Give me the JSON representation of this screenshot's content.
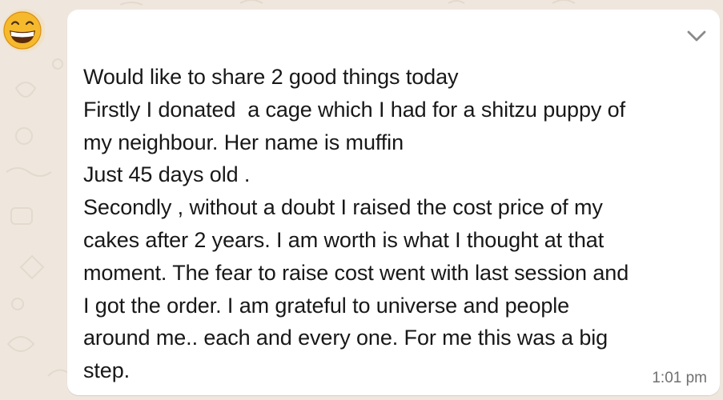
{
  "message": {
    "lines": [
      "Would like to share 2 good things today",
      "Firstly I donated  a cage which I had for a shitzu puppy of",
      "my neighbour. Her name is muffin",
      "Just 45 days old .",
      "Secondly , without a doubt I raised the cost price of my",
      "cakes after 2 years. I am worth is what I thought at that",
      "moment. The fear to raise cost went with last session and",
      "I got the order. I am grateful to universe and people",
      "around me.. each and every one. For me this was a big",
      "step."
    ],
    "time": "1:01 pm"
  },
  "icons": {
    "avatar": "grinning-face-emoji",
    "menu": "chevron-down-icon"
  },
  "colors": {
    "background": "#efe7de",
    "bubble": "#ffffff",
    "text": "#181818",
    "timestamp": "#707070",
    "chevron": "#8a8a8a"
  }
}
